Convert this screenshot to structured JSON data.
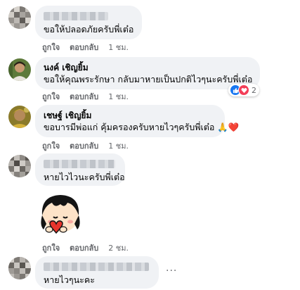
{
  "comments": [
    {
      "text": "ขอให้ปลอดภัยครับพี่เต๋อ",
      "like_label": "ถูกใจ",
      "reply_label": "ตอบกลับ",
      "time": "1 ชม."
    },
    {
      "author": "นงค์ เชิญยิ้ม",
      "text": "ขอให้คุณพระรักษา กลับมาหายเป็นปกติไวๆนะครับพี่เต๋อ",
      "like_label": "ถูกใจ",
      "reply_label": "ตอบกลับ",
      "time": "1 ชม.",
      "reaction_count": "2"
    },
    {
      "author": "เชษฐ์ เชิญยิ้ม",
      "text": "ขอบารมีพ่อแก่ คุ้มครองครับหายไวๆครับพี่เต๋อ",
      "emoji": "🙏❤️",
      "like_label": "ถูกใจ",
      "reply_label": "ตอบกลับ",
      "time": "1 ชม."
    },
    {
      "text": "หายไวไวนะครับพี่เต๋อ",
      "like_label": "ถูกใจ",
      "reply_label": "ตอบกลับ",
      "time": "2 ชม."
    },
    {
      "text": "หายไวๆนะคะ"
    }
  ],
  "more_options": "···",
  "icons": {
    "like": "like-icon",
    "love": "love-icon",
    "heart": "heart-icon"
  },
  "colors": {
    "bubble": "#f0f2f5",
    "meta_text": "#65676b",
    "like_blue": "#1877f2",
    "love_red": "#f33e58"
  }
}
